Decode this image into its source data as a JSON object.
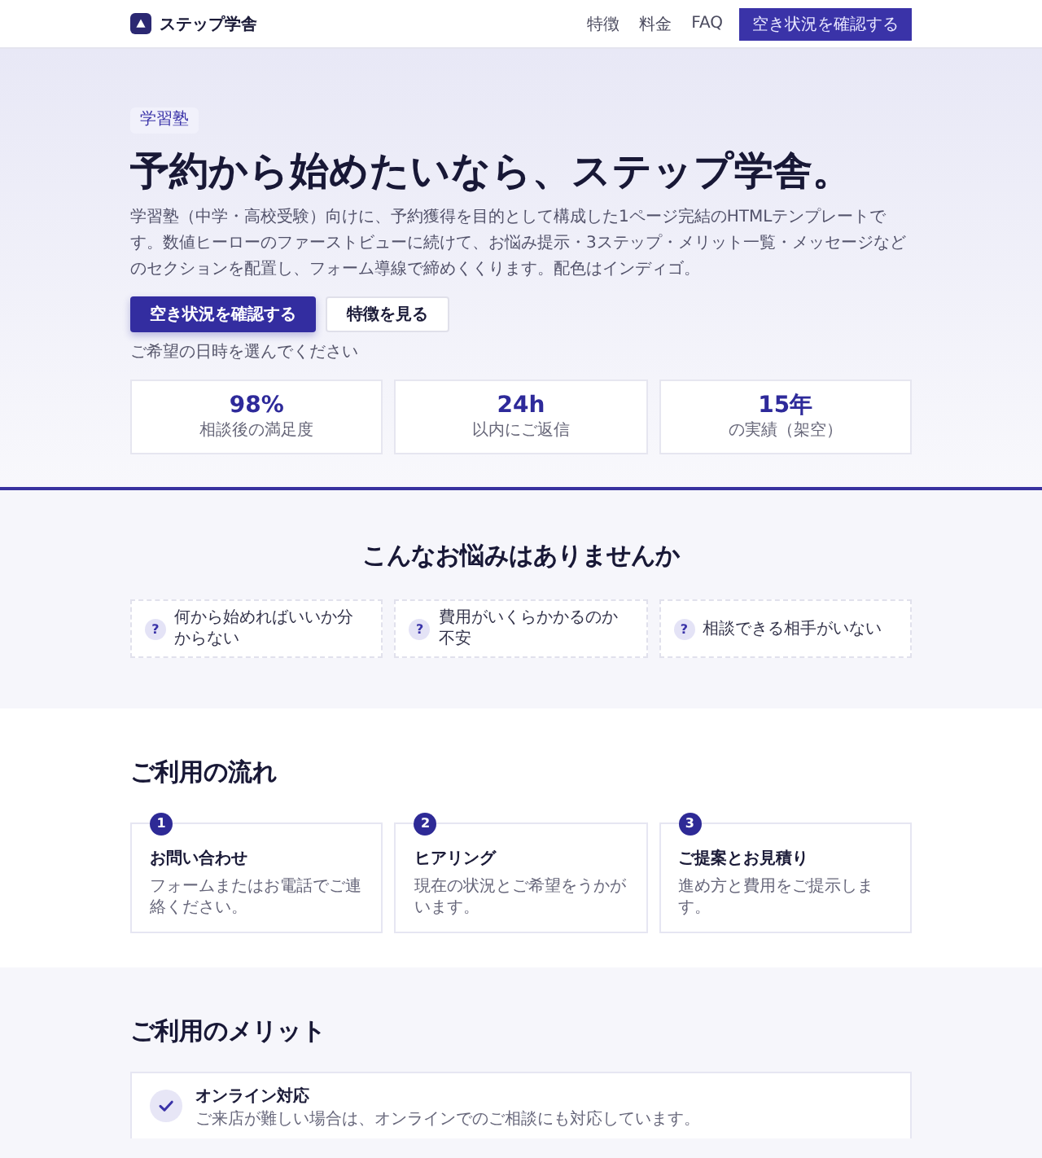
{
  "header": {
    "brand": "ステップ学舎",
    "nav": [
      "特徴",
      "料金",
      "FAQ"
    ],
    "cta": "空き状況を確認する"
  },
  "hero": {
    "badge": "学習塾",
    "title": "予約から始めたいなら、ステップ学舎。",
    "description": "学習塾（中学・高校受験）向けに、予約獲得を目的として構成した1ページ完結のHTMLテンプレートです。数値ヒーローのファーストビューに続けて、お悩み提示・3ステップ・メリット一覧・メッセージなどのセクションを配置し、フォーム導線で締めくくります。配色はインディゴ。",
    "buttons": [
      {
        "label": "空き状況を確認する",
        "kind": "primary"
      },
      {
        "label": "特徴を見る",
        "kind": "secondary"
      }
    ],
    "note": "ご希望の日時を選んでください",
    "stats": [
      {
        "value": "98%",
        "label": "相談後の満足度"
      },
      {
        "value": "24h",
        "label": "以内にご返信"
      },
      {
        "value": "15年",
        "label": "の実績（架空）"
      }
    ]
  },
  "problems": {
    "title": "こんなお悩みはありませんか",
    "items": [
      {
        "icon": "?",
        "text": "何から始めればいいか分からない"
      },
      {
        "icon": "?",
        "text": "費用がいくらかかるのか不安"
      },
      {
        "icon": "?",
        "text": "相談できる相手がいない"
      }
    ]
  },
  "steps": {
    "title": "ご利用の流れ",
    "items": [
      {
        "number": "1",
        "title": "お問い合わせ",
        "text": "フォームまたはお電話でご連絡ください。"
      },
      {
        "number": "2",
        "title": "ヒアリング",
        "text": "現在の状況とご希望をうかがいます。"
      },
      {
        "number": "3",
        "title": "ご提案とお見積り",
        "text": "進め方と費用をご提示します。"
      }
    ]
  },
  "merits": {
    "title": "ご利用のメリット",
    "items": [
      {
        "title": "オンライン対応",
        "text": "ご来店が難しい場合は、オンラインでのご相談にも対応しています。"
      }
    ]
  }
}
